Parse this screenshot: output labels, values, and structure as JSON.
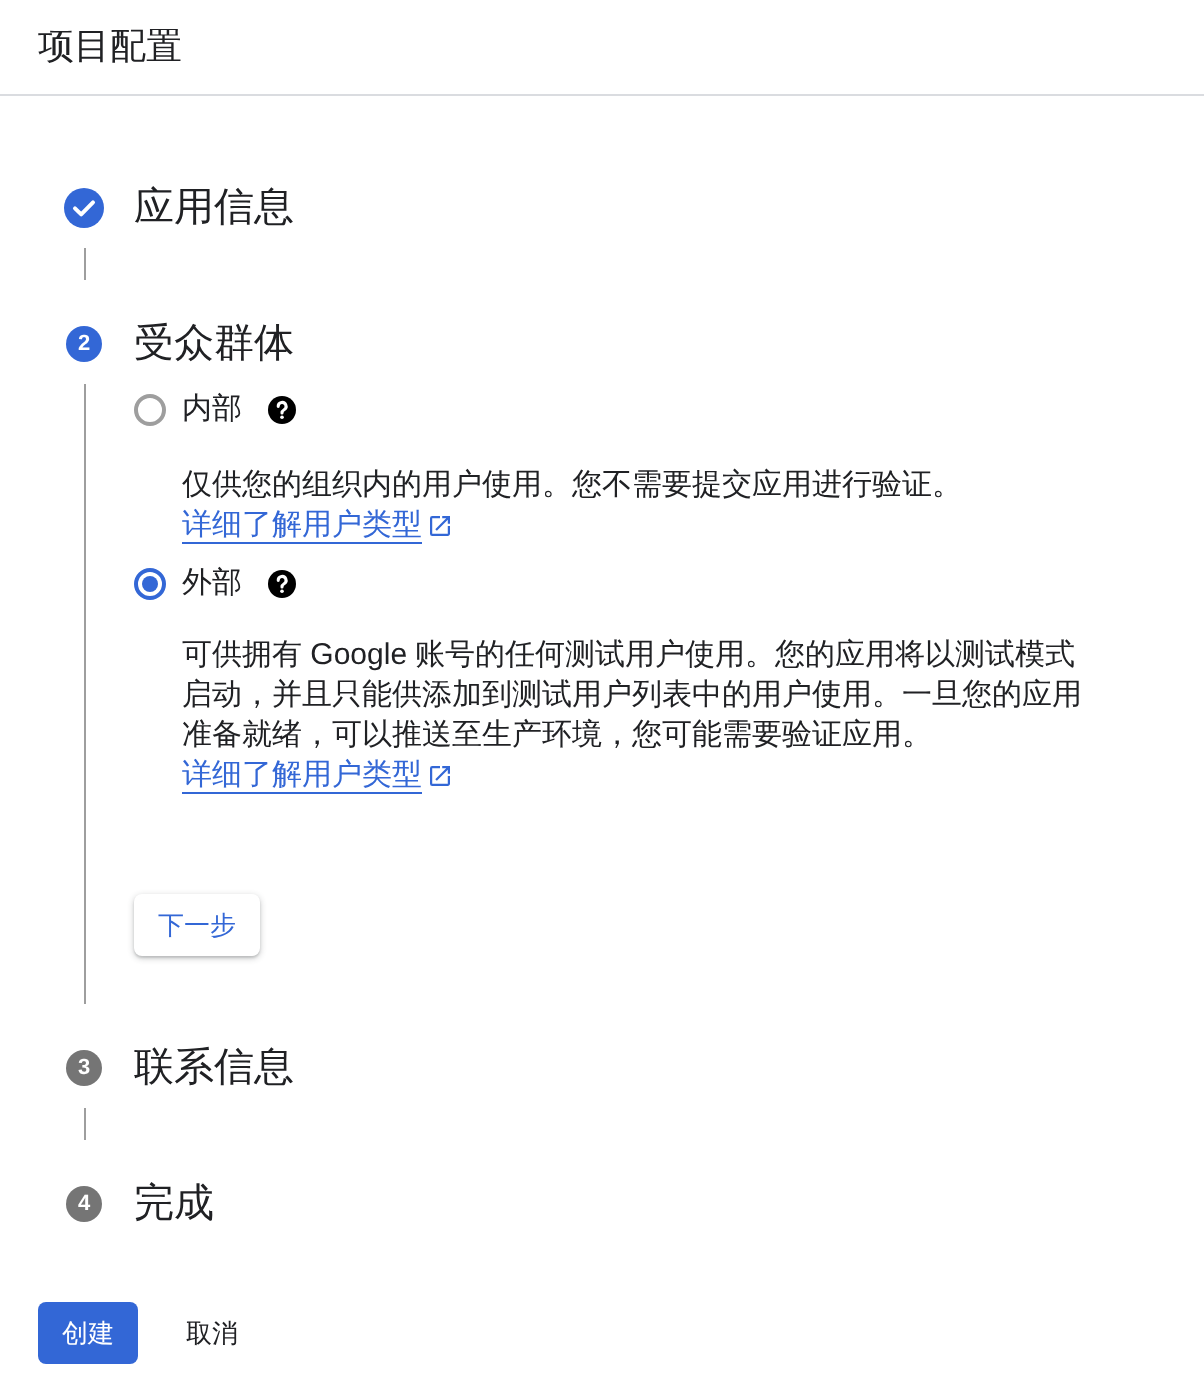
{
  "header": {
    "title": "项目配置"
  },
  "steps": [
    {
      "title": "应用信息",
      "completed": true,
      "current": false
    },
    {
      "number": "2",
      "title": "受众群体",
      "completed": false,
      "current": true,
      "options": [
        {
          "label": "内部",
          "selected": false,
          "description": "仅供您的组织内的用户使用。您不需要提交应用进行验证。",
          "link": "详细了解用户类型"
        },
        {
          "label": "外部",
          "selected": true,
          "description": "可供拥有 Google 账号的任何测试用户使用。您的应用将以测试模式启动，并且只能供添加到测试用户列表中的用户使用。一旦您的应用准备就绪，可以推送至生产环境，您可能需要验证应用。",
          "link": "详细了解用户类型"
        }
      ],
      "next_button": "下一步"
    },
    {
      "number": "3",
      "title": "联系信息",
      "completed": false,
      "current": false
    },
    {
      "number": "4",
      "title": "完成",
      "completed": false,
      "current": false
    }
  ],
  "footer_buttons": [
    {
      "label": "创建",
      "kind": "primary"
    },
    {
      "label": "取消",
      "kind": "text"
    }
  ]
}
